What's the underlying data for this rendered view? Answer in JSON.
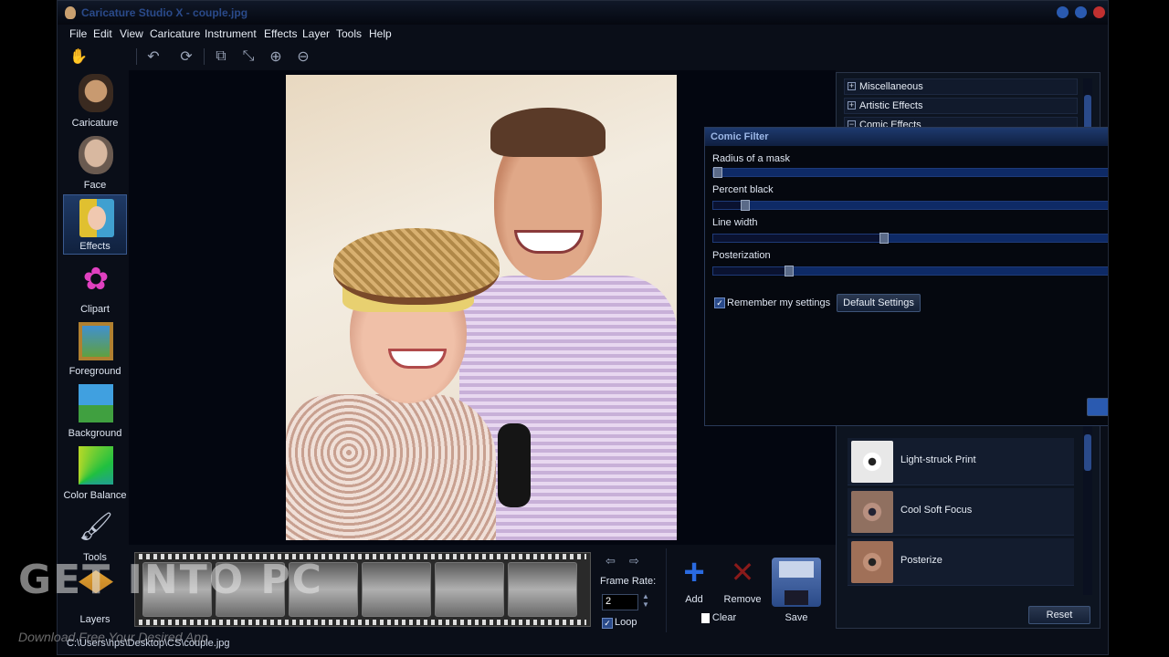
{
  "window": {
    "title": "Caricature Studio X - couple.jpg"
  },
  "menu": [
    "File",
    "Edit",
    "View",
    "Caricature",
    "Instrument",
    "Effects",
    "Layer",
    "Tools",
    "Help"
  ],
  "toolbar": {
    "icons": [
      "hand-icon",
      "undo-icon",
      "rotate-icon",
      "crop-icon",
      "resize-icon",
      "zoom-in-icon",
      "zoom-out-icon"
    ]
  },
  "sidebar": {
    "items": [
      {
        "label": "Caricature",
        "icon": "caricature-icon"
      },
      {
        "label": "Face",
        "icon": "face-icon"
      },
      {
        "label": "Effects",
        "icon": "effects-icon",
        "active": true
      },
      {
        "label": "Clipart",
        "icon": "flower-icon"
      },
      {
        "label": "Foreground",
        "icon": "frame-icon"
      },
      {
        "label": "Background",
        "icon": "landscape-icon"
      },
      {
        "label": "Color Balance",
        "icon": "color-wheel-icon"
      },
      {
        "label": "Tools",
        "icon": "brush-icon"
      },
      {
        "label": "Layers",
        "icon": "layers-icon"
      }
    ]
  },
  "frames": {
    "rate_label": "Frame Rate:",
    "rate_value": "2",
    "loop_label": "Loop"
  },
  "actions": {
    "add": "Add",
    "remove": "Remove",
    "save": "Save",
    "clear": "Clear"
  },
  "effects_tree": {
    "categories": [
      "Miscellaneous",
      "Artistic Effects",
      "Comic Effects"
    ],
    "items": [
      "Light-struck Print",
      "Cool Soft Focus",
      "Posterize"
    ],
    "reset": "Reset"
  },
  "comic_filter": {
    "title": "Comic Filter",
    "sliders": [
      {
        "label": "Radius of a mask",
        "value": 0.0
      },
      {
        "label": "Percent black",
        "value": 0.07
      },
      {
        "label": "Line width",
        "value": 0.42
      },
      {
        "label": "Posterization",
        "value": 0.18
      }
    ],
    "remember_label": "Remember my settings",
    "default_button": "Default Settings"
  },
  "status": {
    "path": "C:\\Users\\hps\\Desktop\\CS\\couple.jpg"
  },
  "watermark": {
    "brand": "GET INTO PC",
    "tagline": "Download Free Your Desired App"
  }
}
